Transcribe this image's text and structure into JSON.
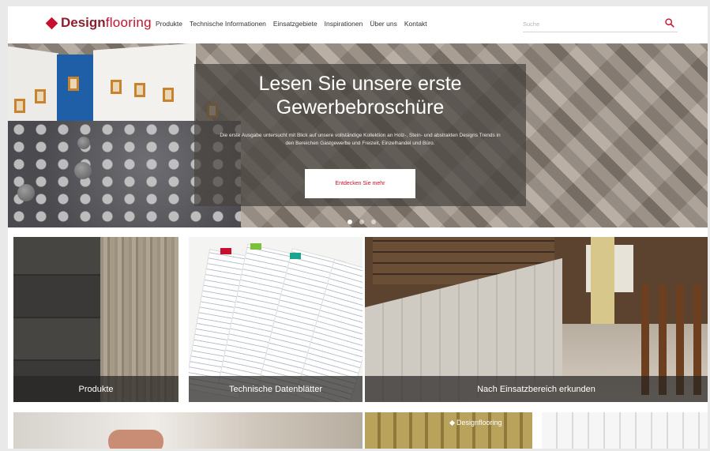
{
  "header": {
    "logo_part1": "Design",
    "logo_part2": "flooring",
    "nav": [
      "Produkte",
      "Technische Informationen",
      "Einsatzgebiete",
      "Inspirationen",
      "Über uns",
      "Kontakt"
    ],
    "search_placeholder": "Suche",
    "search_icon": "search-icon",
    "accent_color": "#c8102e"
  },
  "hero": {
    "title": "Lesen Sie unsere erste Gewerbebroschüre",
    "description": "Die erste Ausgabe untersucht mit Blick auf unsere vollständige Kollektion an Holz-, Stein- und abstrakten Designs Trends in den Bereichen Gastgewerbe und Freizeit, Einzelhandel und Büro.",
    "cta": "Entdecken Sie mehr",
    "slides": 3,
    "active_slide": 1
  },
  "tiles": [
    {
      "caption": "Produkte"
    },
    {
      "caption": "Technische Datenblätter"
    },
    {
      "caption": "Nach Einsatzbereich erkunden"
    }
  ],
  "bottom_tiles": {
    "logo_text": "Designflooring"
  }
}
